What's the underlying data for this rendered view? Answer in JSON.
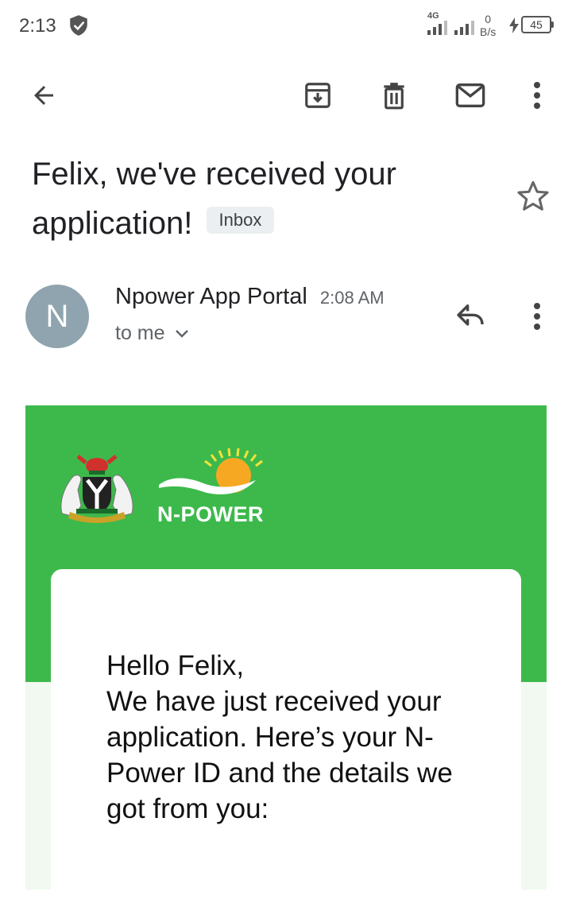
{
  "status_bar": {
    "time": "2:13",
    "network": "4G",
    "speed_value": "0",
    "speed_unit": "B/s",
    "battery": "45"
  },
  "toolbar": {
    "back": "arrow-left-icon",
    "archive": "archive-icon",
    "delete": "trash-icon",
    "mark_unread": "mail-icon",
    "more": "more-vert-icon"
  },
  "email": {
    "subject_line1": "Felix, we've received your",
    "subject_line2": "application!",
    "label": "Inbox",
    "sender_initial": "N",
    "sender_name": "Npower App Portal",
    "time": "2:08 AM",
    "recipient": "to me",
    "body": {
      "brand": "N-POWER",
      "greeting": "Hello Felix,",
      "paragraph": "We have just received your application. Here’s your N-Power ID and the details we got from you:"
    }
  },
  "colors": {
    "banner_green": "#3db94c",
    "avatar": "#8fa4ae",
    "chip_bg": "#eceff1"
  }
}
